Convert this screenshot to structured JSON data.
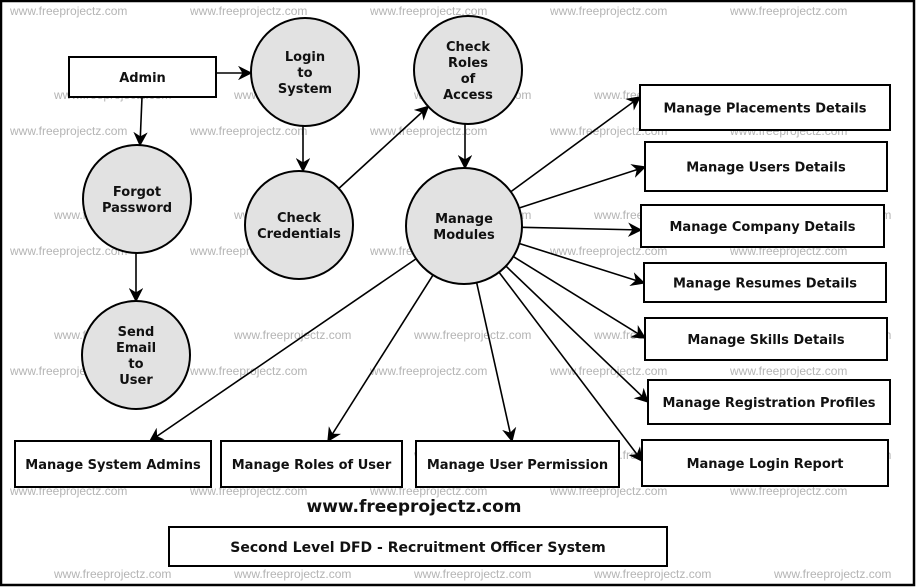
{
  "diagram": {
    "type": "data-flow-diagram",
    "title": "Second Level DFD - Recruitment Officer System",
    "website": "www.freeprojectz.com",
    "watermark": "www.freeprojectz.com",
    "colors": {
      "process_fill": "#e2e2e2",
      "stroke": "#000000",
      "watermark": "#b4b4b4"
    },
    "entities": [
      {
        "id": "admin",
        "label": "Admin"
      },
      {
        "id": "placements",
        "label": "Manage Placements Details"
      },
      {
        "id": "users",
        "label": "Manage Users Details"
      },
      {
        "id": "company",
        "label": "Manage Company Details"
      },
      {
        "id": "resumes",
        "label": "Manage Resumes Details"
      },
      {
        "id": "skills",
        "label": "Manage Skills Details"
      },
      {
        "id": "registration",
        "label": "Manage Registration Profiles"
      },
      {
        "id": "loginreport",
        "label": "Manage Login Report"
      },
      {
        "id": "sysadmins",
        "label": "Manage System Admins"
      },
      {
        "id": "roles",
        "label": "Manage Roles of User"
      },
      {
        "id": "permission",
        "label": "Manage User Permission"
      }
    ],
    "processes": [
      {
        "id": "login",
        "lines": [
          "Login",
          "to",
          "System"
        ]
      },
      {
        "id": "checkroles",
        "lines": [
          "Check",
          "Roles",
          "of",
          "Access"
        ]
      },
      {
        "id": "forgot",
        "lines": [
          "Forgot",
          "Password"
        ]
      },
      {
        "id": "checkcred",
        "lines": [
          "Check",
          "Credentials"
        ]
      },
      {
        "id": "modules",
        "lines": [
          "Manage",
          "Modules"
        ]
      },
      {
        "id": "sendemail",
        "lines": [
          "Send",
          "Email",
          "to",
          "User"
        ]
      }
    ],
    "flows": [
      {
        "from": "admin",
        "to": "login"
      },
      {
        "from": "admin",
        "to": "forgot"
      },
      {
        "from": "login",
        "to": "checkcred"
      },
      {
        "from": "checkcred",
        "to": "checkroles"
      },
      {
        "from": "checkroles",
        "to": "modules"
      },
      {
        "from": "forgot",
        "to": "sendemail"
      },
      {
        "from": "modules",
        "to": "placements"
      },
      {
        "from": "modules",
        "to": "users"
      },
      {
        "from": "modules",
        "to": "company"
      },
      {
        "from": "modules",
        "to": "resumes"
      },
      {
        "from": "modules",
        "to": "skills"
      },
      {
        "from": "modules",
        "to": "registration"
      },
      {
        "from": "modules",
        "to": "loginreport"
      },
      {
        "from": "modules",
        "to": "sysadmins"
      },
      {
        "from": "modules",
        "to": "roles"
      },
      {
        "from": "modules",
        "to": "permission"
      }
    ]
  }
}
